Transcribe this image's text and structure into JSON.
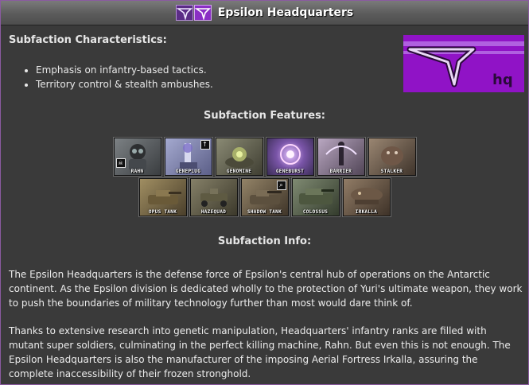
{
  "window": {
    "title": "Epsilon Headquarters"
  },
  "characteristics": {
    "heading": "Subfaction Characteristics:",
    "bullets": [
      "Emphasis on infantry-based tactics.",
      "Territory control & stealth ambushes."
    ]
  },
  "banner": {
    "logo_text": "hq",
    "color": "#9013c6"
  },
  "features": {
    "heading": "Subfaction Features:",
    "row1": [
      {
        "label": "RAHN",
        "icon": "infantry-icon",
        "color": "#5a5f63"
      },
      {
        "label": "GENEPLUG",
        "icon": "structure-icon",
        "color": "#8b8fb7"
      },
      {
        "label": "GENOMINE",
        "icon": "mine-icon",
        "color": "#6b6a56"
      },
      {
        "label": "GENEBURST",
        "icon": "burst-icon",
        "color": "#6f5a8f"
      },
      {
        "label": "BARRIER",
        "icon": "barrier-icon",
        "color": "#8a7c8f"
      },
      {
        "label": "STALKER",
        "icon": "creature-icon",
        "color": "#6f5d4d"
      }
    ],
    "row2": [
      {
        "label": "OPUS TANK",
        "icon": "tank-icon",
        "color": "#7a6a46"
      },
      {
        "label": "HAZEQUAD",
        "icon": "vehicle-icon",
        "color": "#5f5a44"
      },
      {
        "label": "SHADOW TANK",
        "icon": "tank-icon",
        "color": "#6e6250"
      },
      {
        "label": "COLOSSUS",
        "icon": "tank-icon",
        "color": "#5a6450"
      },
      {
        "label": "IRKALLA",
        "icon": "airship-icon",
        "color": "#6b5a4a"
      }
    ]
  },
  "info": {
    "heading": "Subfaction Info:",
    "paragraph1": "The Epsilon Headquarters is the defense force of Epsilon's central hub of operations on the Antarctic continent. As the Epsilon division is dedicated wholly to the protection of Yuri's ultimate weapon, they work to push the boundaries of military technology further than most would dare think of.",
    "paragraph2": "Thanks to extensive research into genetic manipulation, Headquarters' infantry ranks are filled with mutant super soldiers, culminating in the perfect killing machine, Rahn. But even this is not enough. The Epsilon Headquarters is also the manufacturer of the imposing Aerial Fortress Irkalla, assuring the complete inaccessibility of their frozen stronghold."
  }
}
